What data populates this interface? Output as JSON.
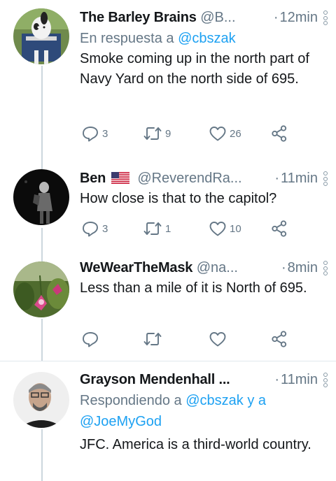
{
  "tweets": [
    {
      "name": "The Barley Brains",
      "handle": "@B...",
      "time": "12min",
      "reply_prefix": "En respuesta a ",
      "reply_link": "@cbszak",
      "text": "Smoke coming up in the north part of Navy Yard on the north side of 695.",
      "replies": "3",
      "retweets": "9",
      "likes": "26"
    },
    {
      "name": "Ben",
      "handle": "@ReverendRa...",
      "time": "11min",
      "text": "How close is that to the capitol?",
      "replies": "3",
      "retweets": "1",
      "likes": "10"
    },
    {
      "name": "WeWearTheMask",
      "handle": "@na...",
      "time": "8min",
      "text": "Less than a mile of it is North of 695."
    },
    {
      "name": "Grayson Mendenhall ...",
      "time": "11min",
      "reply_prefix": "Respondiendo a ",
      "reply_link": "@cbszak y a @JoeMyGod",
      "text": "JFC. America is a third-world country."
    }
  ],
  "icons": [
    "reply-icon",
    "retweet-icon",
    "like-icon",
    "share-icon",
    "more-options-icon",
    "us-flag-icon"
  ],
  "colors": {
    "muted": "#657786",
    "link": "#1da1f2",
    "thread_line": "#ccd6dd",
    "divider": "#e1e8ed"
  }
}
